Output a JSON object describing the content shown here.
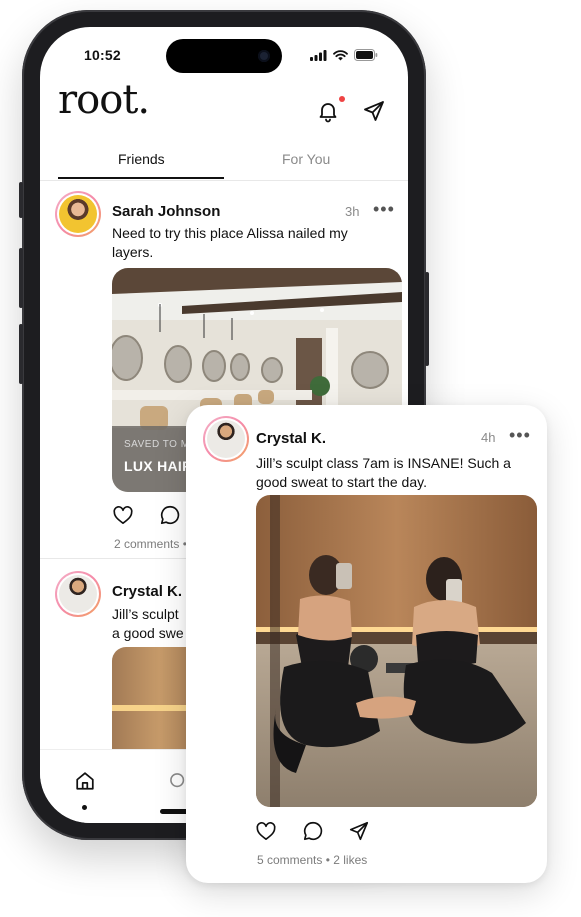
{
  "status_bar": {
    "time": "10:52"
  },
  "app": {
    "logo": "root."
  },
  "tabs": [
    {
      "label": "Friends",
      "active": true
    },
    {
      "label": "For You",
      "active": false
    }
  ],
  "feed": {
    "post1": {
      "name": "Sarah Johnson",
      "time": "3h",
      "menu": "•••",
      "text": "Need to try this place Alissa nailed my layers.",
      "saved_label": "SAVED TO M",
      "place_label": "LUX HAIR",
      "meta": "2 comments •"
    },
    "post2": {
      "name": "Crystal K.",
      "text_line1": "Jill’s sculpt",
      "text_line2": "a good swe"
    }
  },
  "card": {
    "name": "Crystal K.",
    "time": "4h",
    "menu": "•••",
    "text": "Jill’s sculpt class 7am is INSANE! Such a good sweat to start the day.",
    "meta": "5 comments • 2 likes"
  },
  "icons": {
    "bell": "bell-icon",
    "send": "send-icon",
    "heart": "heart-icon",
    "comment": "comment-icon",
    "home": "home-icon",
    "search": "search-icon"
  },
  "colors": {
    "accent_dot": "#ef4444",
    "avatar_ring": "#f58aa8",
    "text_primary": "#111111",
    "text_muted": "#8a8a8a"
  }
}
